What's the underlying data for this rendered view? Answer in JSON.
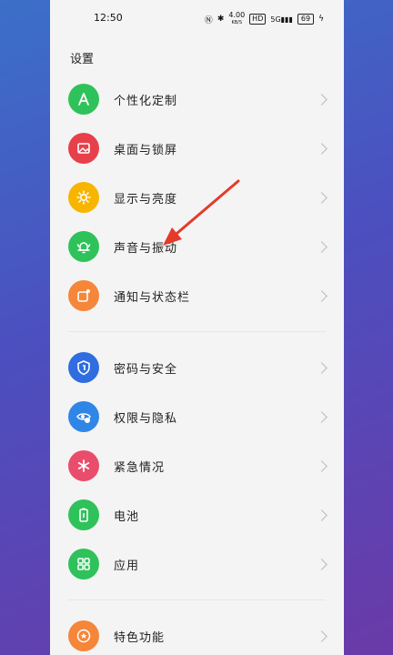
{
  "status": {
    "time": "12:50",
    "net_speed": "4.00",
    "net_unit": "KB/S",
    "hd": "HD",
    "signal": "5G",
    "battery": "69"
  },
  "page_title": "设置",
  "colors": {
    "green": "#2fc25b",
    "red": "#e8404b",
    "yellow": "#f7b500",
    "orange": "#f5863a",
    "blue": "#2f6de0",
    "lightblue": "#2f86e6",
    "pink": "#ea4d6b"
  },
  "items": [
    {
      "label": "个性化定制",
      "icon": "personalization-icon",
      "color": "#2fc25b"
    },
    {
      "label": "桌面与锁屏",
      "icon": "wallpaper-icon",
      "color": "#e8404b"
    },
    {
      "label": "显示与亮度",
      "icon": "brightness-icon",
      "color": "#f7b500"
    },
    {
      "label": "声音与振动",
      "icon": "bell-icon",
      "color": "#2fc25b"
    },
    {
      "label": "通知与状态栏",
      "icon": "notification-icon",
      "color": "#f5863a"
    },
    {
      "label": "密码与安全",
      "icon": "shield-icon",
      "color": "#2f6de0"
    },
    {
      "label": "权限与隐私",
      "icon": "privacy-icon",
      "color": "#2f86e6"
    },
    {
      "label": "紧急情况",
      "icon": "emergency-icon",
      "color": "#ea4d6b"
    },
    {
      "label": "电池",
      "icon": "battery-icon",
      "color": "#2fc25b"
    },
    {
      "label": "应用",
      "icon": "apps-icon",
      "color": "#2fc25b"
    },
    {
      "label": "特色功能",
      "icon": "star-icon",
      "color": "#f5863a"
    }
  ]
}
